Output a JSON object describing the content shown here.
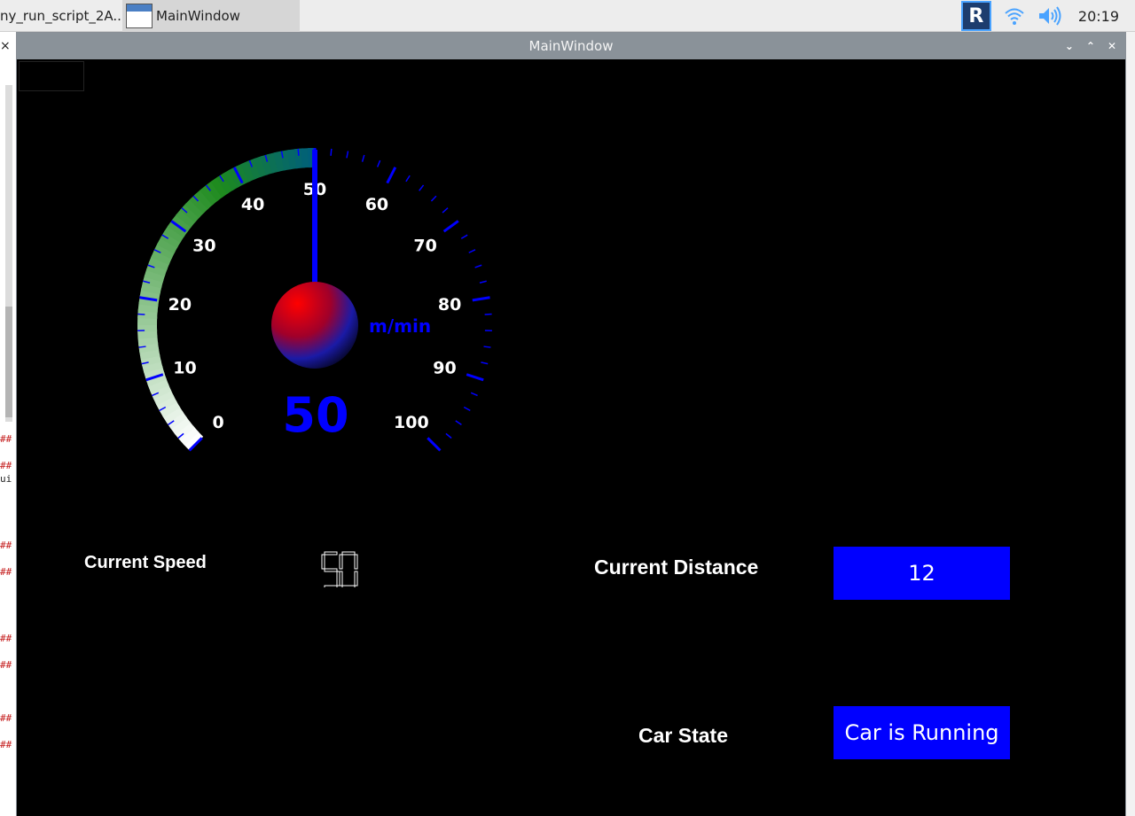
{
  "taskbar": {
    "task1_label": "ny_run_script_2A...",
    "task2_label": "MainWindow",
    "vnc_label": "R",
    "clock": "20:19"
  },
  "background_editor": {
    "hash_lines": [
      "##",
      "##",
      "##",
      "##",
      "##",
      "##",
      "##",
      "##"
    ],
    "ui_text": "ui",
    "close_glyph": "×"
  },
  "window": {
    "title": "MainWindow",
    "controls": [
      "⌄",
      "⌃",
      "✕"
    ]
  },
  "gauge": {
    "min": 0,
    "max": 100,
    "value": 50,
    "unit": "m/min",
    "value_text": "50",
    "tick_labels": [
      "0",
      "10",
      "20",
      "30",
      "40",
      "50",
      "60",
      "70",
      "80",
      "90",
      "100"
    ],
    "arc_start_color": "#ffffff",
    "arc_mid_color": "#1e8a1e",
    "arc_end_color": "#005f7a",
    "tick_color": "#0000ff",
    "needle_color": "#0000ff",
    "hub_colors": [
      "#ff0000",
      "#1a1aa6",
      "#000000"
    ]
  },
  "panel": {
    "speed_label": "Current Speed",
    "speed_lcd": "50",
    "distance_label": "Current Distance",
    "distance_value": "12",
    "state_label": "Car State",
    "state_value": "Car is Running",
    "box_color": "#0000ff"
  }
}
